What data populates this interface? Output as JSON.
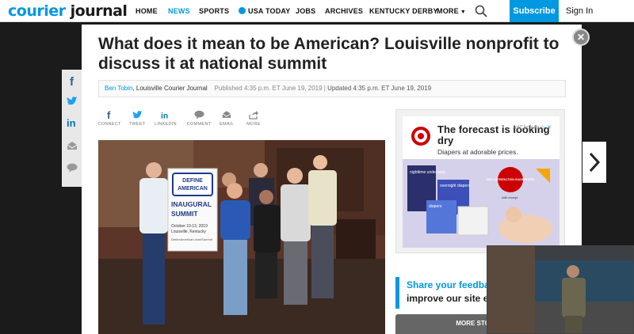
{
  "brand": {
    "logo_part1": "courier",
    "logo_part2": "journal",
    "accent": "#0098e0"
  },
  "nav": {
    "home": "HOME",
    "news": "NEWS",
    "sports": "SPORTS",
    "usatoday": "USA TODAY",
    "jobs": "JOBS",
    "archives": "ARCHIVES",
    "derby": "KENTUCKY DERBY",
    "more": "MORE",
    "subscribe": "Subscribe",
    "signin": "Sign In"
  },
  "article": {
    "headline": "What does it mean to be American? Louisville nonprofit to discuss it at national summit",
    "author": "Ben Tobin",
    "org": ", Louisville Courier Journal",
    "published": "Published 4:35 p.m. ET June 19, 2019",
    "separator": " | ",
    "updated": "Updated 4:35 p.m. ET June 19, 2019"
  },
  "share": {
    "connect": "CONNECT",
    "tweet": "TWEET",
    "linkedin": "LINKEDIN",
    "comment": "COMMENT",
    "email": "EMAIL",
    "more": "MORE"
  },
  "photo": {
    "sign_line1": "DEFINE",
    "sign_line2": "AMERICAN",
    "sign_line3": "INAUGURAL",
    "sign_line4": "SUMMIT",
    "sign_line5": "October 10-13, 2019",
    "sign_line6": "Louisville, Kentucky",
    "sign_line7": "DefineAmerican.com/Summit"
  },
  "ad": {
    "adchoices": "AdChoices",
    "headline": "The forecast is looking dry",
    "sub": "Diapers at adorable prices.",
    "pkg1": "nighttime underwear",
    "pkg2": "overnight diapers",
    "pkg3": "diapers",
    "badge": "100% SATISFACTION GUARANTEED",
    "badge_note": "with receipt"
  },
  "feedback": {
    "line1": "Share your feedback",
    "line2": "improve our site experience!"
  },
  "more_stories": "MORE STORIES"
}
